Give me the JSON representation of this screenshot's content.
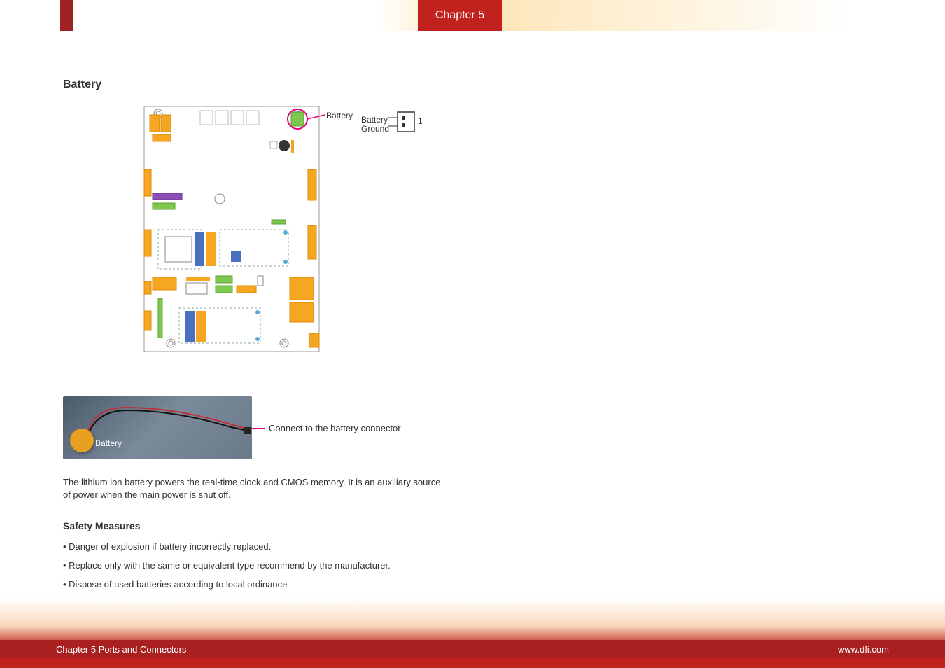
{
  "header": {
    "chapter_tab": "Chapter 5"
  },
  "section": {
    "title": "Battery"
  },
  "diagram": {
    "battery_label": "Battery",
    "pin_labels": {
      "battery": "Battery",
      "ground": "Ground",
      "pin1": "1"
    }
  },
  "photo": {
    "battery_label": "Battery",
    "annotation": "Connect to the battery connector"
  },
  "description": "The lithium ion battery powers the real-time clock and CMOS memory. It is an auxiliary source of power when the main power is shut off.",
  "safety": {
    "title": "Safety Measures",
    "items": [
      "Danger of explosion if battery incorrectly replaced.",
      "Replace only with the same or equivalent type recommend by the manufacturer.",
      "Dispose of used batteries according to local ordinance"
    ]
  },
  "footer": {
    "left": "Chapter 5 Ports and Connectors",
    "right": "www.dfi.com"
  }
}
